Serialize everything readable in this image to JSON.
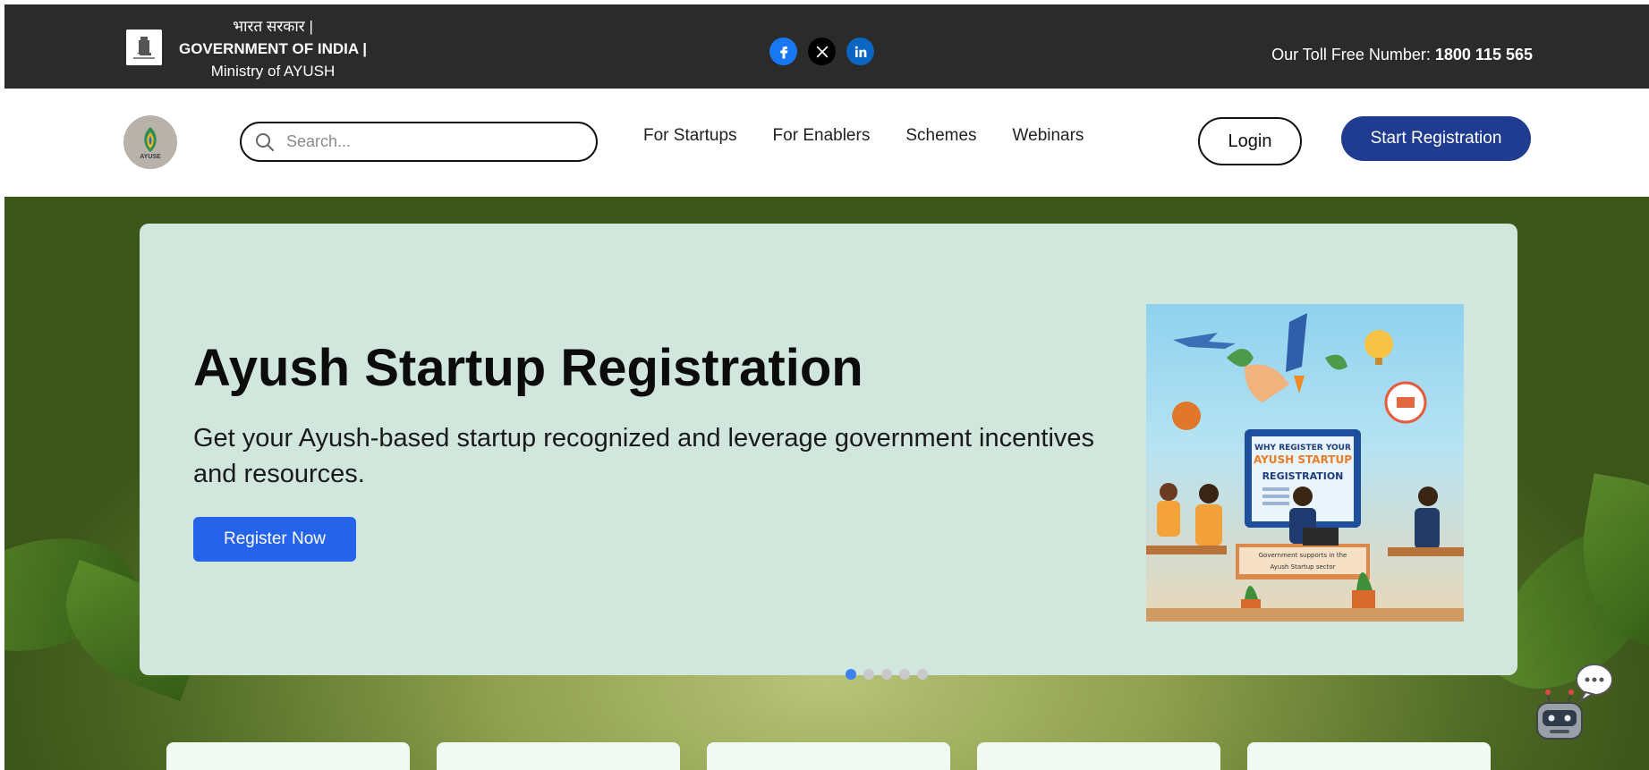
{
  "topbar": {
    "gov_hindi": "भारत सरकार |",
    "gov_english": "GOVERNMENT OF INDIA |",
    "ministry": "Ministry of AYUSH",
    "toll_label": "Our Toll Free Number:",
    "toll_number": "1800 115 565",
    "socials": [
      "facebook-icon",
      "x-twitter-icon",
      "linkedin-icon"
    ]
  },
  "nav": {
    "logo_text": "AYUSE",
    "search_placeholder": "Search...",
    "menu": [
      {
        "label": "For Startups"
      },
      {
        "label": "For Enablers"
      },
      {
        "label": "Schemes"
      },
      {
        "label": "Webinars"
      }
    ],
    "login_label": "Login",
    "register_label": "Start Registration"
  },
  "hero": {
    "title": "Ayush Startup Registration",
    "subtitle": "Get your Ayush-based startup recognized and leverage government incentives and resources.",
    "cta_label": "Register Now",
    "illustration": {
      "line1": "WHY REGISTER YOUR",
      "line2": "AYUSH STARTUP",
      "line3": "REGISTRATION",
      "caption1": "Government supports in the",
      "caption2": "Ayush Startup sector"
    },
    "carousel": {
      "count": 5,
      "active": 0
    }
  },
  "colors": {
    "topbar": "#2b2b2b",
    "primary_nav": "#1f3c91",
    "cta": "#2563eb",
    "card_bg": "#d1e6dd"
  }
}
